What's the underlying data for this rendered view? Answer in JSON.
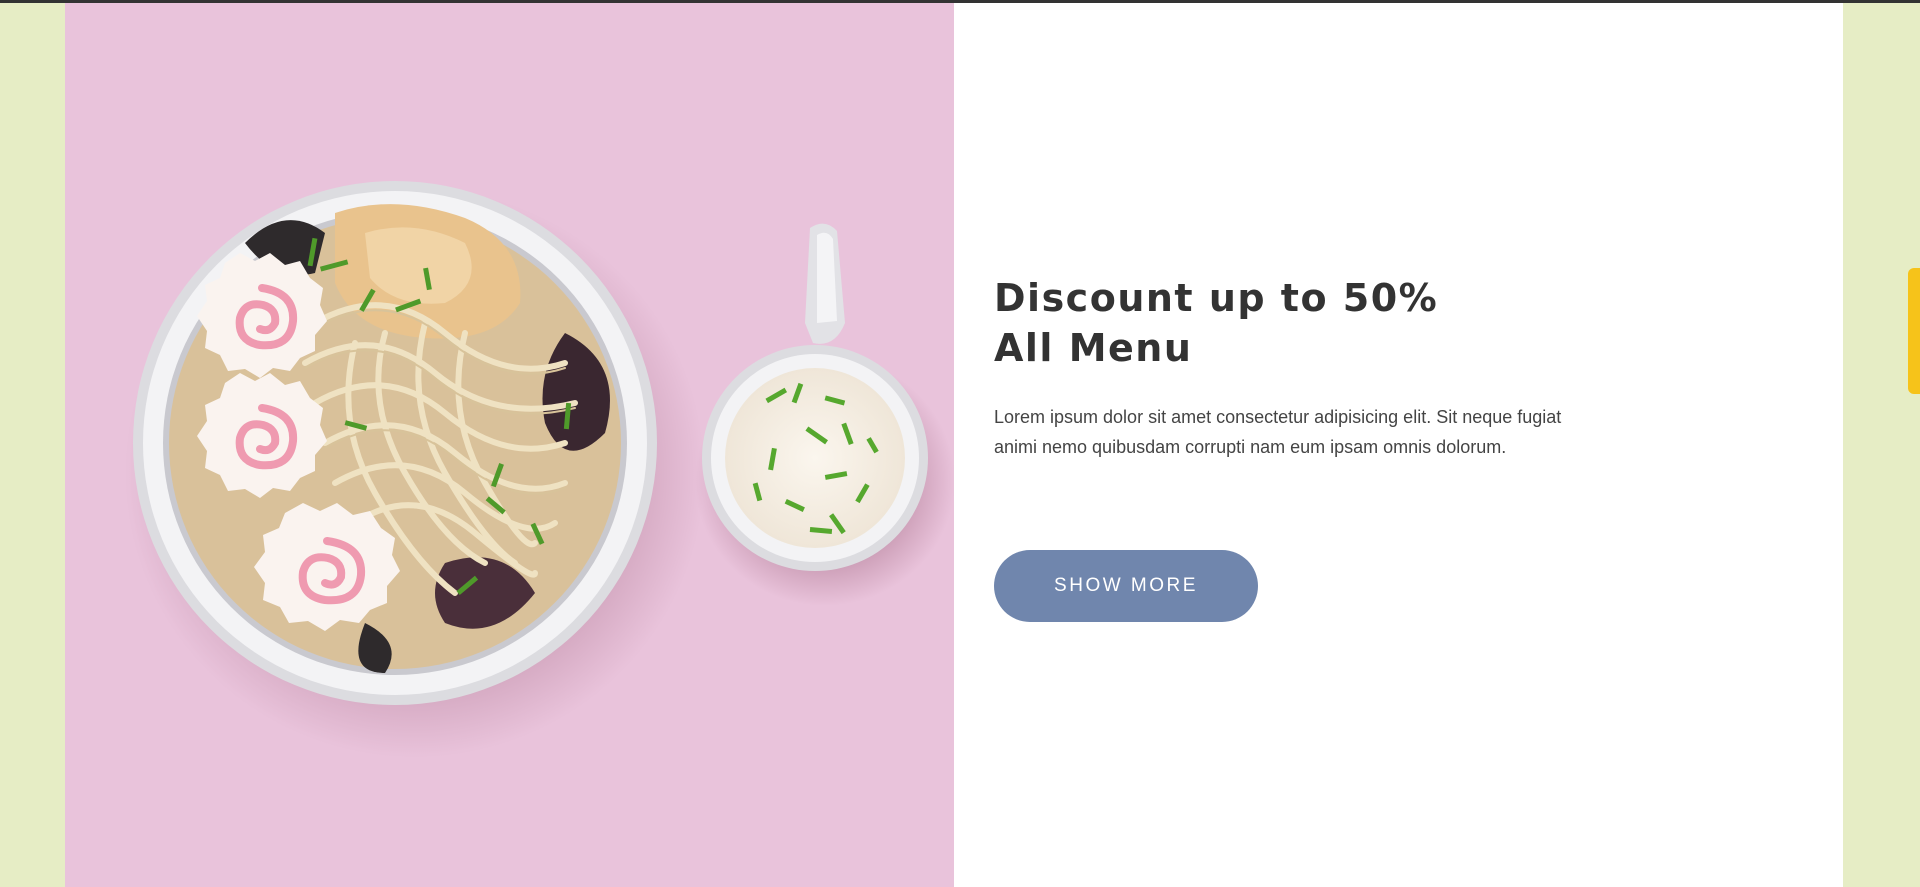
{
  "promo": {
    "heading_line1": "Discount up to 50%",
    "heading_line2": "All Menu",
    "description": "Lorem ipsum dolor sit amet consectetur adipisicing elit. Sit neque fugiat animi nemo quibusdam corrupti nam eum ipsam omnis dolorum.",
    "button_label": "SHOW MORE"
  },
  "colors": {
    "page_background": "#e6edc5",
    "image_background": "#e9c3db",
    "button": "#7086ad",
    "heading_text": "#333333",
    "scroll_indicator": "#f6c31a"
  },
  "image": {
    "subject": "ramen bowl with narutomaki and a small sauce dish"
  }
}
